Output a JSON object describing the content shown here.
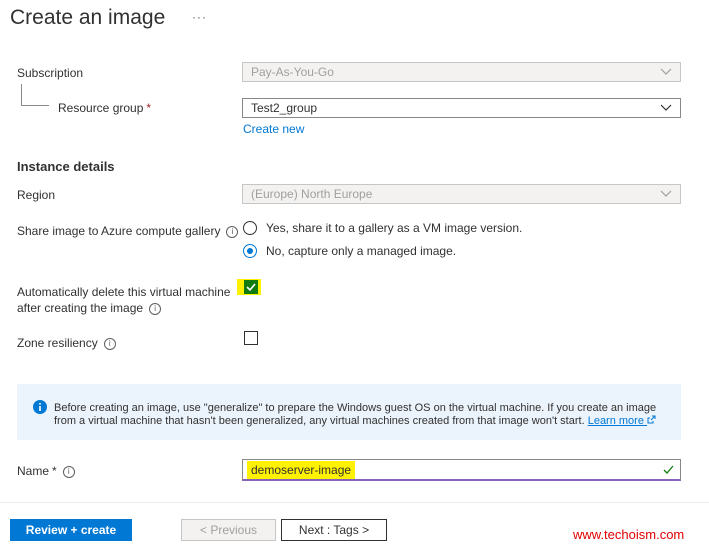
{
  "page": {
    "title": "Create an image",
    "more": "···"
  },
  "subscription": {
    "label": "Subscription",
    "value": "Pay-As-You-Go"
  },
  "resource_group": {
    "label": "Resource group",
    "required": "*",
    "value": "Test2_group",
    "create_new": "Create new"
  },
  "instance_details": {
    "heading": "Instance details"
  },
  "region": {
    "label": "Region",
    "value": "(Europe) North Europe"
  },
  "share_gallery": {
    "label": "Share image to Azure compute gallery",
    "info": "i",
    "options": [
      {
        "label": "Yes, share it to a gallery as a VM image version.",
        "selected": false
      },
      {
        "label": "No, capture only a managed image.",
        "selected": true
      }
    ]
  },
  "auto_delete": {
    "label_line1": "Automatically delete this virtual machine",
    "label_line2": "after creating the image",
    "info": "i",
    "checked": true
  },
  "zone_resiliency": {
    "label": "Zone resiliency",
    "info": "i",
    "checked": false
  },
  "banner": {
    "text": "Before creating an image, use \"generalize\" to prepare the Windows guest OS on the virtual machine. If you create an image from a virtual machine that hasn't been generalized, any virtual machines created from that image won't start.",
    "link": "Learn more"
  },
  "name": {
    "label": "Name",
    "required": "*",
    "info": "i",
    "value": "demoserver-image"
  },
  "footer": {
    "review_create": "Review + create",
    "previous": "< Previous",
    "next": "Next : Tags >"
  },
  "watermark": "www.techoism.com",
  "colors": {
    "accent": "#0078d4",
    "checkbox_checked": "#107c10",
    "highlight": "#fff200",
    "watermark": "#e00000"
  }
}
